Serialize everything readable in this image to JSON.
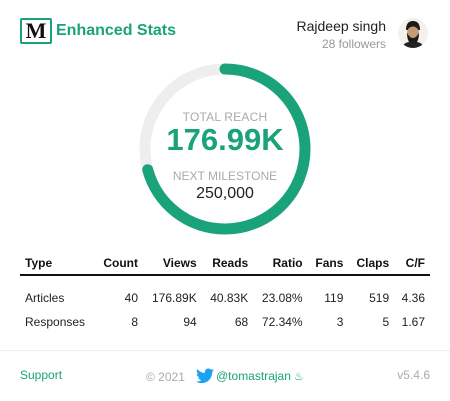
{
  "app": {
    "logo_letter": "M",
    "title": "Enhanced Stats",
    "accent_color": "#1aa37a"
  },
  "user": {
    "name": "Rajdeep singh",
    "followers": "28 followers",
    "avatar_icon": "user-avatar"
  },
  "reach": {
    "label": "TOTAL REACH",
    "value": "176.99K",
    "milestone_label": "NEXT MILESTONE",
    "milestone_value": "250,000",
    "progress_fraction": 0.708
  },
  "table": {
    "headers": [
      "Type",
      "Count",
      "Views",
      "Reads",
      "Ratio",
      "Fans",
      "Claps",
      "C/F"
    ],
    "rows": [
      [
        "Articles",
        "40",
        "176.89K",
        "40.83K",
        "23.08%",
        "119",
        "519",
        "4.36"
      ],
      [
        "Responses",
        "8",
        "94",
        "68",
        "72.34%",
        "3",
        "5",
        "1.67"
      ]
    ]
  },
  "footer": {
    "support": "Support",
    "copyright": "© 2021",
    "twitter_handle": "@tomastrajan",
    "version": "v5.4.6"
  }
}
